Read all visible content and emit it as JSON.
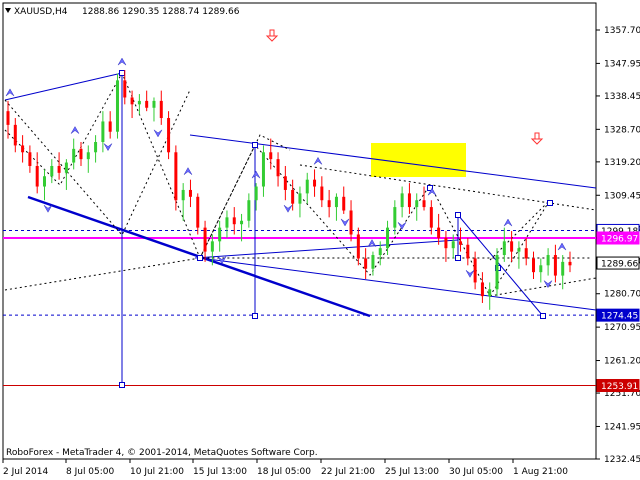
{
  "header": {
    "symbol": "XAUUSD,H4",
    "ohlc": "1288.86 1290.35 1288.74 1289.66"
  },
  "footer": {
    "copyright": "RoboForex - MetaTrader 4, © 2001-2014, MetaQuotes Software Corp."
  },
  "colors": {
    "bull": "#33cc33",
    "bear": "#ff0000",
    "trend": "#0000cc",
    "magenta": "#ff00ff",
    "support_red": "#cc0000",
    "target_box": "#ffff00",
    "arrow_up": "#4444ff",
    "arrow_down": "#ff3333"
  },
  "chart_data": {
    "type": "candlestick",
    "y_ticks": [
      "1357.70",
      "1347.95",
      "1338.45",
      "1328.70",
      "1319.20",
      "1309.45",
      "1299.70",
      "1290.20",
      "1280.70",
      "1270.95",
      "1261.20",
      "1251.70",
      "1241.95",
      "1232.45"
    ],
    "x_ticks": [
      "2 Jul 2014",
      "8 Jul 05:00",
      "10 Jul 21:00",
      "15 Jul 13:00",
      "18 Jul 05:00",
      "22 Jul 21:00",
      "25 Jul 13:00",
      "30 Jul 05:00",
      "1 Aug 21:00"
    ],
    "price_tags": [
      {
        "label": "1299.18",
        "price": 1299.18,
        "style": "light"
      },
      {
        "label": "1296.97",
        "price": 1296.97,
        "style": "magenta"
      },
      {
        "label": "1289.66",
        "price": 1289.66,
        "style": "white"
      },
      {
        "label": "1274.45",
        "price": 1274.45,
        "style": "blue"
      },
      {
        "label": "1253.91",
        "price": 1253.91,
        "style": "red"
      }
    ],
    "horizontal_levels": [
      {
        "price": 1299.18,
        "color": "#0000cc",
        "dash": true
      },
      {
        "price": 1296.97,
        "color": "#ff00ff",
        "dash": false
      },
      {
        "price": 1274.45,
        "color": "#0000cc",
        "dash": true
      },
      {
        "price": 1253.91,
        "color": "#cc0000",
        "dash": false
      }
    ],
    "candles": [
      [
        1334,
        1337,
        1326,
        1330
      ],
      [
        1330,
        1332,
        1322,
        1324
      ],
      [
        1324,
        1327,
        1319,
        1322
      ],
      [
        1322,
        1324,
        1316,
        1318
      ],
      [
        1318,
        1322,
        1310,
        1312
      ],
      [
        1312,
        1317,
        1308,
        1315
      ],
      [
        1315,
        1320,
        1313,
        1318
      ],
      [
        1318,
        1322,
        1314,
        1316
      ],
      [
        1316,
        1320,
        1311,
        1319
      ],
      [
        1319,
        1326,
        1317,
        1323
      ],
      [
        1323,
        1325,
        1318,
        1320
      ],
      [
        1320,
        1324,
        1316,
        1322
      ],
      [
        1322,
        1327,
        1319,
        1325
      ],
      [
        1325,
        1334,
        1322,
        1331
      ],
      [
        1331,
        1334,
        1326,
        1328
      ],
      [
        1328,
        1345,
        1326,
        1343
      ],
      [
        1343,
        1346,
        1336,
        1338
      ],
      [
        1338,
        1340,
        1332,
        1336
      ],
      [
        1336,
        1339,
        1333,
        1337
      ],
      [
        1337,
        1340,
        1334,
        1335
      ],
      [
        1335,
        1338,
        1331,
        1337
      ],
      [
        1337,
        1340,
        1330,
        1332
      ],
      [
        1332,
        1334,
        1320,
        1322
      ],
      [
        1322,
        1324,
        1305,
        1308
      ],
      [
        1308,
        1313,
        1302,
        1311
      ],
      [
        1311,
        1314,
        1306,
        1309
      ],
      [
        1309,
        1310,
        1298,
        1300
      ],
      [
        1300,
        1302,
        1290,
        1293
      ],
      [
        1293,
        1298,
        1289,
        1296
      ],
      [
        1296,
        1302,
        1293,
        1300
      ],
      [
        1300,
        1305,
        1297,
        1303
      ],
      [
        1303,
        1306,
        1298,
        1301
      ],
      [
        1301,
        1304,
        1296,
        1302
      ],
      [
        1302,
        1310,
        1300,
        1308
      ],
      [
        1308,
        1313,
        1305,
        1312
      ],
      [
        1312,
        1324,
        1309,
        1322
      ],
      [
        1322,
        1326,
        1317,
        1320
      ],
      [
        1320,
        1322,
        1312,
        1315
      ],
      [
        1315,
        1318,
        1308,
        1311
      ],
      [
        1311,
        1314,
        1305,
        1307
      ],
      [
        1307,
        1312,
        1303,
        1310
      ],
      [
        1310,
        1316,
        1307,
        1314
      ],
      [
        1314,
        1317,
        1309,
        1312
      ],
      [
        1312,
        1315,
        1306,
        1308
      ],
      [
        1308,
        1311,
        1303,
        1306
      ],
      [
        1306,
        1310,
        1302,
        1309
      ],
      [
        1309,
        1312,
        1304,
        1305
      ],
      [
        1305,
        1308,
        1296,
        1298
      ],
      [
        1298,
        1300,
        1289,
        1291
      ],
      [
        1291,
        1294,
        1285,
        1288
      ],
      [
        1288,
        1293,
        1286,
        1292
      ],
      [
        1292,
        1296,
        1289,
        1294
      ],
      [
        1294,
        1302,
        1292,
        1300
      ],
      [
        1300,
        1308,
        1298,
        1306
      ],
      [
        1306,
        1312,
        1303,
        1310
      ],
      [
        1310,
        1313,
        1304,
        1306
      ],
      [
        1306,
        1310,
        1302,
        1308
      ],
      [
        1308,
        1312,
        1305,
        1306
      ],
      [
        1306,
        1308,
        1298,
        1300
      ],
      [
        1300,
        1304,
        1295,
        1297
      ],
      [
        1297,
        1299,
        1290,
        1294
      ],
      [
        1294,
        1298,
        1291,
        1296
      ],
      [
        1296,
        1300,
        1293,
        1295
      ],
      [
        1295,
        1297,
        1289,
        1291
      ],
      [
        1291,
        1293,
        1282,
        1284
      ],
      [
        1284,
        1287,
        1278,
        1280
      ],
      [
        1280,
        1284,
        1276,
        1282
      ],
      [
        1282,
        1294,
        1280,
        1292
      ],
      [
        1292,
        1300,
        1290,
        1296
      ],
      [
        1296,
        1299,
        1290,
        1293
      ],
      [
        1293,
        1296,
        1288,
        1294
      ],
      [
        1294,
        1297,
        1289,
        1291
      ],
      [
        1291,
        1293,
        1285,
        1287
      ],
      [
        1287,
        1291,
        1284,
        1289
      ],
      [
        1289,
        1294,
        1286,
        1292
      ],
      [
        1292,
        1295,
        1284,
        1286
      ],
      [
        1286,
        1292,
        1282,
        1290
      ],
      [
        1290,
        1293,
        1287,
        1289
      ]
    ]
  }
}
